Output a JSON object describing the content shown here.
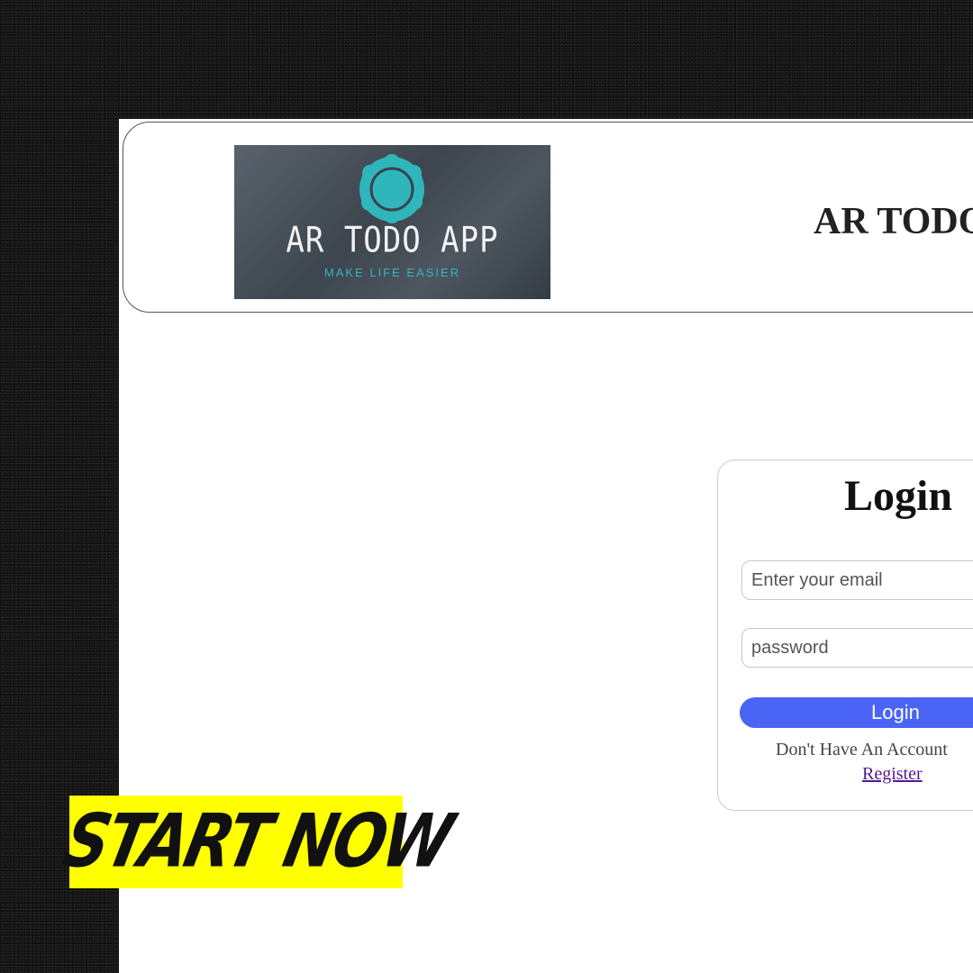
{
  "header": {
    "logo": {
      "title": "AR TODO APP",
      "tagline": "MAKE LIFE EASIER"
    },
    "app_title": "AR TODO"
  },
  "login": {
    "heading": "Login",
    "email_placeholder": "Enter your email",
    "password_placeholder": "password",
    "button_label": "Login",
    "register_prompt": "Don't Have An Account",
    "register_link": "Register"
  },
  "promo": {
    "label": "START NOW"
  },
  "colors": {
    "page_background": "#0f0f0f",
    "login_button": "#4a64f5",
    "logo_accent": "#2fb6bd",
    "promo_background": "#ffff00",
    "register_link": "#551a8b"
  }
}
